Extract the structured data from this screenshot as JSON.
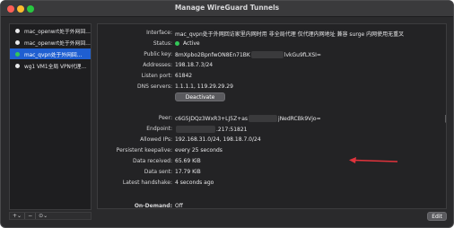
{
  "window": {
    "title": "Manage WireGuard Tunnels"
  },
  "sidebar": {
    "tunnels": [
      {
        "name": "mac_openwrt处于外网回…",
        "status": "inactive"
      },
      {
        "name": "mac_openwrt处于外网回…",
        "status": "inactive"
      },
      {
        "name": "mac_qvpn处于外网回…",
        "status": "active"
      },
      {
        "name": "wg1 VM1全局 VPN代理…",
        "status": "inactive"
      }
    ],
    "controls": {
      "add": "+",
      "add_menu": "⌄",
      "remove": "−",
      "more": "⊙⌄"
    }
  },
  "interface": {
    "labels": {
      "interface": "Interface:",
      "status": "Status:",
      "public_key": "Public key:",
      "addresses": "Addresses:",
      "listen_port": "Listen port:",
      "dns_servers": "DNS servers:"
    },
    "name": "mac_qvpn处于外网回访家里内网时用 非全局代理 仅代理内网地址 兼容 surge 内网使用无重叉",
    "status": "Active",
    "public_key_prefix": "8mXpbo2BpnfwON8En71BK",
    "public_key_suffix": "lvkGu9fLXSI=",
    "addresses": "198.18.7.3/24",
    "listen_port": "61842",
    "dns_servers": "1.1.1.1, 119.29.29.29",
    "deactivate_label": "Deactivate"
  },
  "peer": {
    "labels": {
      "peer": "Peer:",
      "endpoint": "Endpoint:",
      "allowed_ips": "Allowed IPs:",
      "persistent_keepalive": "Persistent keepalive:",
      "data_received": "Data received:",
      "data_sent": "Data sent:",
      "latest_handshake": "Latest handshake:",
      "on_demand": "On-Demand:"
    },
    "public_key_prefix": "c6G5JDQz3WxR3+LJ5Z+as",
    "public_key_suffix": "jNedRCBk9Vjo=",
    "endpoint_suffix": ".217:51821",
    "allowed_ips": "192.168.31.0/24, 198.18.7.0/24",
    "persistent_keepalive": "every 25 seconds",
    "data_received": "65.69 KiB",
    "data_sent": "17.79 KiB",
    "latest_handshake": "4 seconds ago",
    "on_demand": "Off"
  },
  "footer": {
    "edit_label": "Edit"
  },
  "colors": {
    "accent": "#1f5fd1",
    "active": "#34c759",
    "annotation_arrow": "#e0333c"
  },
  "icons": [
    "close-icon",
    "minimize-icon",
    "maximize-icon",
    "status-dot-icon",
    "mouse-cursor-icon",
    "arrow-annotation-icon"
  ]
}
